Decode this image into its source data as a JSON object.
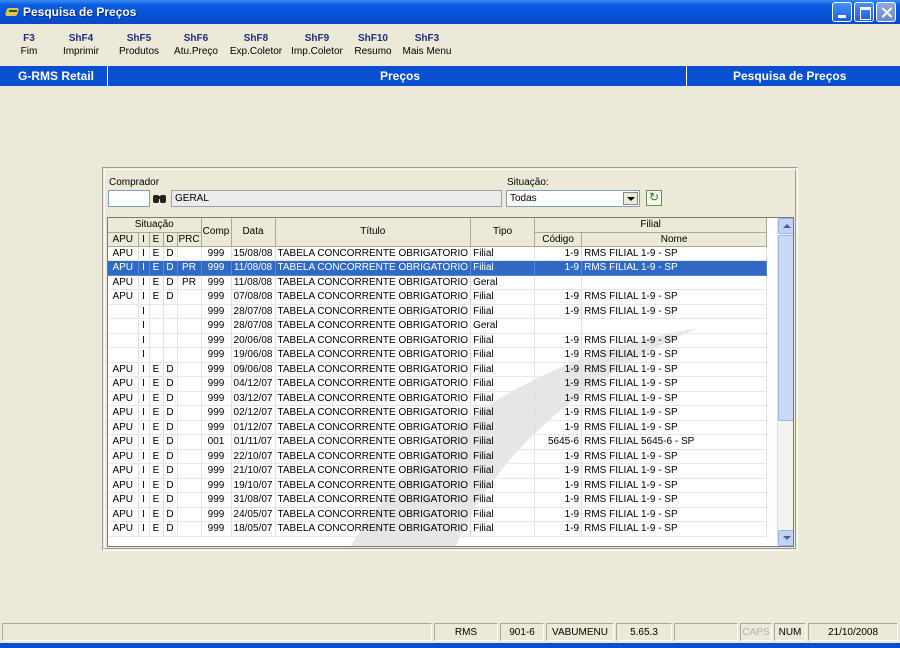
{
  "window": {
    "title": "Pesquisa de Preços"
  },
  "fkeys": [
    {
      "key": "F3",
      "label": "Fim"
    },
    {
      "key": "ShF4",
      "label": "Imprimir"
    },
    {
      "key": "ShF5",
      "label": "Produtos"
    },
    {
      "key": "ShF6",
      "label": "Atu.Preço"
    },
    {
      "key": "ShF8",
      "label": "Exp.Coletor"
    },
    {
      "key": "ShF9",
      "label": "Imp.Coletor"
    },
    {
      "key": "ShF10",
      "label": "Resumo"
    },
    {
      "key": "ShF3",
      "label": "Mais Menu"
    }
  ],
  "header": {
    "left": "G-RMS Retail",
    "center": "Preços",
    "right": "Pesquisa de Preços"
  },
  "filters": {
    "comprador_label": "Comprador",
    "comprador_code": "",
    "comprador_name": "GERAL",
    "situacao_label": "Situação:",
    "situacao_value": "Todas"
  },
  "grid": {
    "group_headers": {
      "situacao": "Situação",
      "filial": "Filial"
    },
    "columns": {
      "apu": "APU",
      "i": "I",
      "e": "E",
      "d": "D",
      "prc": "PRC",
      "comp": "Comp",
      "data": "Data",
      "titulo": "Título",
      "tipo": "Tipo",
      "codigo": "Código",
      "nome": "Nome"
    },
    "rows": [
      [
        "APU",
        "I",
        "E",
        "D",
        "",
        "999",
        "15/08/08",
        "TABELA CONCORRENTE OBRIGATORIO",
        "Filial",
        "1-9",
        "RMS FILIAL 1-9 - SP"
      ],
      [
        "APU",
        "I",
        "E",
        "D",
        "PR",
        "999",
        "11/08/08",
        "TABELA CONCORRENTE OBRIGATORIO",
        "Filial",
        "1-9",
        "RMS FILIAL 1-9 - SP"
      ],
      [
        "APU",
        "I",
        "E",
        "D",
        "PR",
        "999",
        "11/08/08",
        "TABELA CONCORRENTE OBRIGATORIO",
        "Geral",
        "",
        ""
      ],
      [
        "APU",
        "I",
        "E",
        "D",
        "",
        "999",
        "07/08/08",
        "TABELA CONCORRENTE OBRIGATORIO",
        "Filial",
        "1-9",
        "RMS FILIAL 1-9 - SP"
      ],
      [
        "",
        "I",
        "",
        "",
        "",
        "999",
        "28/07/08",
        "TABELA CONCORRENTE OBRIGATORIO",
        "Filial",
        "1-9",
        "RMS FILIAL 1-9 - SP"
      ],
      [
        "",
        "I",
        "",
        "",
        "",
        "999",
        "28/07/08",
        "TABELA CONCORRENTE OBRIGATORIO",
        "Geral",
        "",
        ""
      ],
      [
        "",
        "I",
        "",
        "",
        "",
        "999",
        "20/06/08",
        "TABELA CONCORRENTE OBRIGATORIO",
        "Filial",
        "1-9",
        "RMS FILIAL 1-9 - SP"
      ],
      [
        "",
        "I",
        "",
        "",
        "",
        "999",
        "19/06/08",
        "TABELA CONCORRENTE OBRIGATORIO",
        "Filial",
        "1-9",
        "RMS FILIAL 1-9 - SP"
      ],
      [
        "APU",
        "I",
        "E",
        "D",
        "",
        "999",
        "09/06/08",
        "TABELA CONCORRENTE OBRIGATORIO",
        "Filial",
        "1-9",
        "RMS FILIAL 1-9 - SP"
      ],
      [
        "APU",
        "I",
        "E",
        "D",
        "",
        "999",
        "04/12/07",
        "TABELA CONCORRENTE OBRIGATORIO",
        "Filial",
        "1-9",
        "RMS FILIAL 1-9 - SP"
      ],
      [
        "APU",
        "I",
        "E",
        "D",
        "",
        "999",
        "03/12/07",
        "TABELA CONCORRENTE OBRIGATORIO",
        "Filial",
        "1-9",
        "RMS FILIAL 1-9 - SP"
      ],
      [
        "APU",
        "I",
        "E",
        "D",
        "",
        "999",
        "02/12/07",
        "TABELA CONCORRENTE OBRIGATORIO",
        "Filial",
        "1-9",
        "RMS FILIAL 1-9 - SP"
      ],
      [
        "APU",
        "I",
        "E",
        "D",
        "",
        "999",
        "01/12/07",
        "TABELA CONCORRENTE OBRIGATORIO",
        "Filial",
        "1-9",
        "RMS FILIAL 1-9 - SP"
      ],
      [
        "APU",
        "I",
        "E",
        "D",
        "",
        "001",
        "01/11/07",
        "TABELA CONCORRENTE OBRIGATORIO",
        "Filial",
        "5645-6",
        "RMS FILIAL 5645-6 - SP"
      ],
      [
        "APU",
        "I",
        "E",
        "D",
        "",
        "999",
        "22/10/07",
        "TABELA CONCORRENTE OBRIGATORIO",
        "Filial",
        "1-9",
        "RMS FILIAL 1-9 - SP"
      ],
      [
        "APU",
        "I",
        "E",
        "D",
        "",
        "999",
        "21/10/07",
        "TABELA CONCORRENTE OBRIGATORIO",
        "Filial",
        "1-9",
        "RMS FILIAL 1-9 - SP"
      ],
      [
        "APU",
        "I",
        "E",
        "D",
        "",
        "999",
        "19/10/07",
        "TABELA CONCORRENTE OBRIGATORIO",
        "Filial",
        "1-9",
        "RMS FILIAL 1-9 - SP"
      ],
      [
        "APU",
        "I",
        "E",
        "D",
        "",
        "999",
        "31/08/07",
        "TABELA CONCORRENTE OBRIGATORIO",
        "Filial",
        "1-9",
        "RMS FILIAL 1-9 - SP"
      ],
      [
        "APU",
        "I",
        "E",
        "D",
        "",
        "999",
        "24/05/07",
        "TABELA CONCORRENTE OBRIGATORIO",
        "Filial",
        "1-9",
        "RMS FILIAL 1-9 - SP"
      ],
      [
        "APU",
        "I",
        "E",
        "D",
        "",
        "999",
        "18/05/07",
        "TABELA CONCORRENTE OBRIGATORIO",
        "Filial",
        "1-9",
        "RMS FILIAL 1-9 - SP"
      ]
    ],
    "selected_row": 1
  },
  "status": {
    "system": "RMS",
    "code": "901-6",
    "menu": "VABUMENU",
    "version": "5.65.3",
    "caps": "CAPS",
    "num": "NUM",
    "date": "21/10/2008"
  },
  "colors": {
    "title_blue": "#0a4fd0",
    "selection": "#316ac5",
    "background": "#ece9d8"
  }
}
